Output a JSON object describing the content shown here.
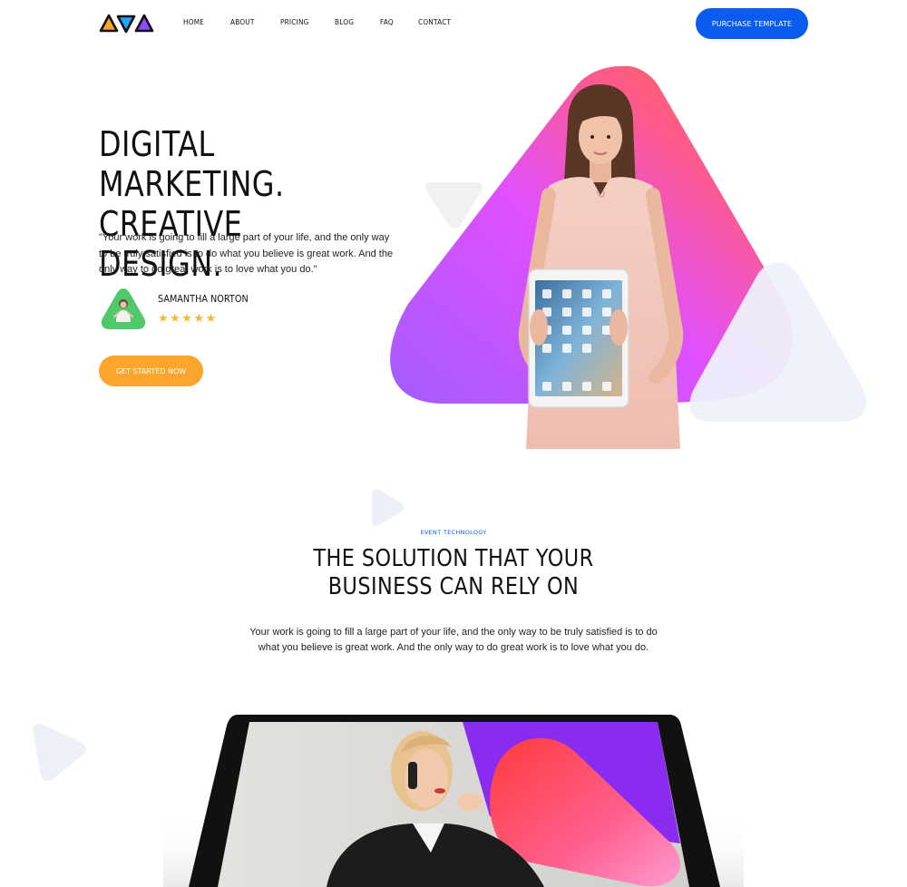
{
  "header": {
    "logo_icon": "triangles-logo",
    "nav": [
      "HOME",
      "ABOUT",
      "PRICING",
      "BLOG",
      "FAQ",
      "CONTACT"
    ],
    "cta_label": "PURCHASE TEMPLATE"
  },
  "hero": {
    "title_line1": "DIGITAL MARKETING.",
    "title_line2": "CREATIVE DESIGN.",
    "quote": "\"Your work is going to fill a large part of your life, and the only way to be truly satisfied is to do what you believe is great work. And the only way to do great work is to love what you do.\"",
    "author": {
      "name": "SAMANTHA NORTON",
      "stars": "★★★★★",
      "rating": 5
    },
    "cta_label": "GET STARTED NOW"
  },
  "solution": {
    "eyebrow": "EVENT TECHNOLOGY",
    "title_line1": "THE SOLUTION THAT YOUR",
    "title_line2": "BUSINESS CAN RELY ON",
    "text": "Your work is going to fill a large part of your life, and the only way to be truly satisfied is to do what you believe is great work. And the only way to do great work is to love what you do."
  },
  "colors": {
    "primary": "#0a5cf0",
    "accent": "#fba52c",
    "gradient_purple": "#9b5cff",
    "gradient_pink": "#ff3fd0",
    "gradient_orange": "#ff6a3d",
    "star": "#f7b731",
    "avatar_bg": "#4fc96a"
  }
}
